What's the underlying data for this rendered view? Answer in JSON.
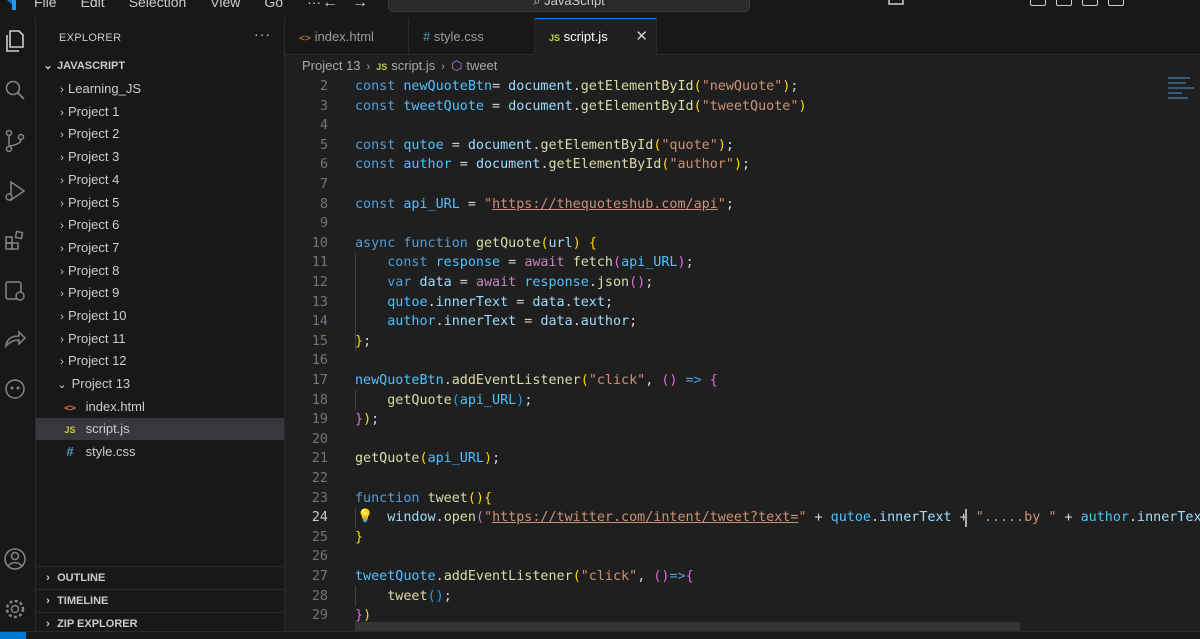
{
  "titlebar": {
    "menu": [
      "File",
      "Edit",
      "Selection",
      "View",
      "Go",
      "···"
    ],
    "nav_back": "←",
    "nav_forward": "→",
    "search_text": "JavaScript"
  },
  "sidebar": {
    "title": "EXPLORER",
    "more": "···",
    "root": "JAVASCRIPT",
    "folders": [
      "Learning_JS",
      "Project 1",
      "Project 2",
      "Project 3",
      "Project 4",
      "Project 5",
      "Project 6",
      "Project 7",
      "Project 8",
      "Project 9",
      "Project 10",
      "Project 11",
      "Project 12"
    ],
    "open_folder": "Project 13",
    "files": [
      {
        "icon": "<>",
        "name": "index.html",
        "type": "html"
      },
      {
        "icon": "JS",
        "name": "script.js",
        "type": "js",
        "selected": true
      },
      {
        "icon": "#",
        "name": "style.css",
        "type": "css"
      }
    ],
    "bottom_sections": [
      "OUTLINE",
      "TIMELINE",
      "ZIP EXPLORER"
    ]
  },
  "tabs": [
    {
      "icon": "<>",
      "label": "index.html",
      "type": "html",
      "active": false
    },
    {
      "icon": "#",
      "label": "style.css",
      "type": "css",
      "active": false
    },
    {
      "icon": "JS",
      "label": "script.js",
      "type": "js",
      "active": true
    }
  ],
  "tab_close": "✕",
  "breadcrumb": {
    "folder": "Project 13",
    "file_icon": "JS",
    "file": "script.js",
    "symbol": "tweet"
  },
  "editor": {
    "current_line": 24,
    "lines": [
      {
        "n": "2",
        "tokens": [
          [
            "kw",
            "const "
          ],
          [
            "cn",
            "newQuoteBtn"
          ],
          [
            "",
            "="
          ],
          [
            "vr",
            " document"
          ],
          [
            "",
            "."
          ],
          [
            "fn",
            "getElementById"
          ],
          [
            "b1",
            "("
          ],
          [
            "st",
            "\"newQuote\""
          ],
          [
            "b1",
            ")"
          ],
          [
            "",
            ";"
          ]
        ]
      },
      {
        "n": "3",
        "tokens": [
          [
            "kw",
            "const "
          ],
          [
            "cn",
            "tweetQuote"
          ],
          [
            "",
            " = "
          ],
          [
            "vr",
            "document"
          ],
          [
            "",
            "."
          ],
          [
            "fn",
            "getElementById"
          ],
          [
            "b1",
            "("
          ],
          [
            "st",
            "\"tweetQuote\""
          ],
          [
            "b1",
            ")"
          ]
        ]
      },
      {
        "n": "4",
        "tokens": []
      },
      {
        "n": "5",
        "tokens": [
          [
            "kw",
            "const "
          ],
          [
            "cn",
            "qutoe"
          ],
          [
            "",
            " = "
          ],
          [
            "vr",
            "document"
          ],
          [
            "",
            "."
          ],
          [
            "fn",
            "getElementById"
          ],
          [
            "b1",
            "("
          ],
          [
            "st",
            "\"quote\""
          ],
          [
            "b1",
            ")"
          ],
          [
            "",
            ";"
          ]
        ]
      },
      {
        "n": "6",
        "tokens": [
          [
            "kw",
            "const "
          ],
          [
            "cn",
            "author"
          ],
          [
            "",
            " = "
          ],
          [
            "vr",
            "document"
          ],
          [
            "",
            "."
          ],
          [
            "fn",
            "getElementById"
          ],
          [
            "b1",
            "("
          ],
          [
            "st",
            "\"author\""
          ],
          [
            "b1",
            ")"
          ],
          [
            "",
            ";"
          ]
        ]
      },
      {
        "n": "7",
        "tokens": []
      },
      {
        "n": "8",
        "tokens": [
          [
            "kw",
            "const "
          ],
          [
            "cn",
            "api_URL"
          ],
          [
            "",
            " = "
          ],
          [
            "st",
            "\""
          ],
          [
            "url",
            "https://thequoteshub.com/api"
          ],
          [
            "st",
            "\""
          ],
          [
            "",
            ";"
          ]
        ]
      },
      {
        "n": "9",
        "tokens": []
      },
      {
        "n": "10",
        "tokens": [
          [
            "kw",
            "async "
          ],
          [
            "kw",
            "function "
          ],
          [
            "fn",
            "getQuote"
          ],
          [
            "b1",
            "("
          ],
          [
            "vr",
            "url"
          ],
          [
            "b1",
            ")"
          ],
          [
            "",
            " "
          ],
          [
            "b1",
            "{"
          ]
        ]
      },
      {
        "n": "11",
        "tokens": [
          [
            "",
            "    "
          ],
          [
            "kw",
            "const "
          ],
          [
            "cn",
            "response"
          ],
          [
            "",
            " = "
          ],
          [
            "kw2",
            "await "
          ],
          [
            "fn",
            "fetch"
          ],
          [
            "b2",
            "("
          ],
          [
            "cn",
            "api_URL"
          ],
          [
            "b2",
            ")"
          ],
          [
            "",
            ";"
          ]
        ]
      },
      {
        "n": "12",
        "tokens": [
          [
            "",
            "    "
          ],
          [
            "kw",
            "var "
          ],
          [
            "vr",
            "data"
          ],
          [
            "",
            " = "
          ],
          [
            "kw2",
            "await "
          ],
          [
            "cn",
            "response"
          ],
          [
            "",
            "."
          ],
          [
            "fn",
            "json"
          ],
          [
            "b2",
            "()"
          ],
          [
            "",
            ";"
          ]
        ]
      },
      {
        "n": "13",
        "tokens": [
          [
            "",
            "    "
          ],
          [
            "cn",
            "qutoe"
          ],
          [
            "",
            "."
          ],
          [
            "vr",
            "innerText"
          ],
          [
            "",
            " = "
          ],
          [
            "vr",
            "data"
          ],
          [
            "",
            "."
          ],
          [
            "vr",
            "text"
          ],
          [
            "",
            ";"
          ]
        ]
      },
      {
        "n": "14",
        "tokens": [
          [
            "",
            "    "
          ],
          [
            "cn",
            "author"
          ],
          [
            "",
            "."
          ],
          [
            "vr",
            "innerText"
          ],
          [
            "",
            " = "
          ],
          [
            "vr",
            "data"
          ],
          [
            "",
            "."
          ],
          [
            "vr",
            "author"
          ],
          [
            "",
            ";"
          ]
        ]
      },
      {
        "n": "15",
        "tokens": [
          [
            "b1",
            "}"
          ],
          [
            "",
            ";"
          ]
        ]
      },
      {
        "n": "16",
        "tokens": []
      },
      {
        "n": "17",
        "tokens": [
          [
            "cn",
            "newQuoteBtn"
          ],
          [
            "",
            "."
          ],
          [
            "fn",
            "addEventListener"
          ],
          [
            "b1",
            "("
          ],
          [
            "st",
            "\"click\""
          ],
          [
            "",
            ", "
          ],
          [
            "b2",
            "()"
          ],
          [
            "",
            " "
          ],
          [
            "kw",
            "=>"
          ],
          [
            "",
            " "
          ],
          [
            "b2",
            "{"
          ]
        ]
      },
      {
        "n": "18",
        "tokens": [
          [
            "",
            "    "
          ],
          [
            "fn",
            "getQuote"
          ],
          [
            "b3",
            "("
          ],
          [
            "cn",
            "api_URL"
          ],
          [
            "b3",
            ")"
          ],
          [
            "",
            ";"
          ]
        ]
      },
      {
        "n": "19",
        "tokens": [
          [
            "b2",
            "}"
          ],
          [
            "b1",
            ")"
          ],
          [
            "",
            ";"
          ]
        ]
      },
      {
        "n": "20",
        "tokens": []
      },
      {
        "n": "21",
        "tokens": [
          [
            "fn",
            "getQuote"
          ],
          [
            "b1",
            "("
          ],
          [
            "cn",
            "api_URL"
          ],
          [
            "b1",
            ")"
          ],
          [
            "",
            ";"
          ]
        ]
      },
      {
        "n": "22",
        "tokens": []
      },
      {
        "n": "23",
        "tokens": [
          [
            "kw",
            "function "
          ],
          [
            "fn",
            "tweet"
          ],
          [
            "b1",
            "()"
          ],
          [
            "b1",
            "{"
          ]
        ]
      },
      {
        "n": "24",
        "tokens": [
          [
            "",
            "    "
          ],
          [
            "vr",
            "window"
          ],
          [
            "",
            "."
          ],
          [
            "fn",
            "open"
          ],
          [
            "b2",
            "("
          ],
          [
            "st",
            "\""
          ],
          [
            "url",
            "https://twitter.com/intent/tweet?text="
          ],
          [
            "st",
            "\""
          ],
          [
            "",
            " + "
          ],
          [
            "cn",
            "qutoe"
          ],
          [
            "",
            "."
          ],
          [
            "vr",
            "innerText"
          ],
          [
            "",
            " + "
          ],
          [
            "st",
            "\".....by \""
          ],
          [
            "",
            " + "
          ],
          [
            "cn",
            "author"
          ],
          [
            "",
            "."
          ],
          [
            "vr",
            "innerText"
          ]
        ]
      },
      {
        "n": "25",
        "tokens": [
          [
            "b1",
            "}"
          ]
        ]
      },
      {
        "n": "26",
        "tokens": []
      },
      {
        "n": "27",
        "tokens": [
          [
            "cn",
            "tweetQuote"
          ],
          [
            "",
            "."
          ],
          [
            "fn",
            "addEventListener"
          ],
          [
            "b1",
            "("
          ],
          [
            "st",
            "\"click\""
          ],
          [
            "",
            ", "
          ],
          [
            "b2",
            "()"
          ],
          [
            "kw",
            "=>"
          ],
          [
            "b2",
            "{"
          ]
        ]
      },
      {
        "n": "28",
        "tokens": [
          [
            "",
            "    "
          ],
          [
            "fn",
            "tweet"
          ],
          [
            "b3",
            "()"
          ],
          [
            "",
            ";"
          ]
        ]
      },
      {
        "n": "29",
        "tokens": [
          [
            "b2",
            "}"
          ],
          [
            "b1",
            ")"
          ]
        ]
      }
    ],
    "lightbulb": "💡"
  },
  "colors": {
    "accent": "#0078d4",
    "background": "#1f1f1f",
    "sidebar": "#181818"
  }
}
